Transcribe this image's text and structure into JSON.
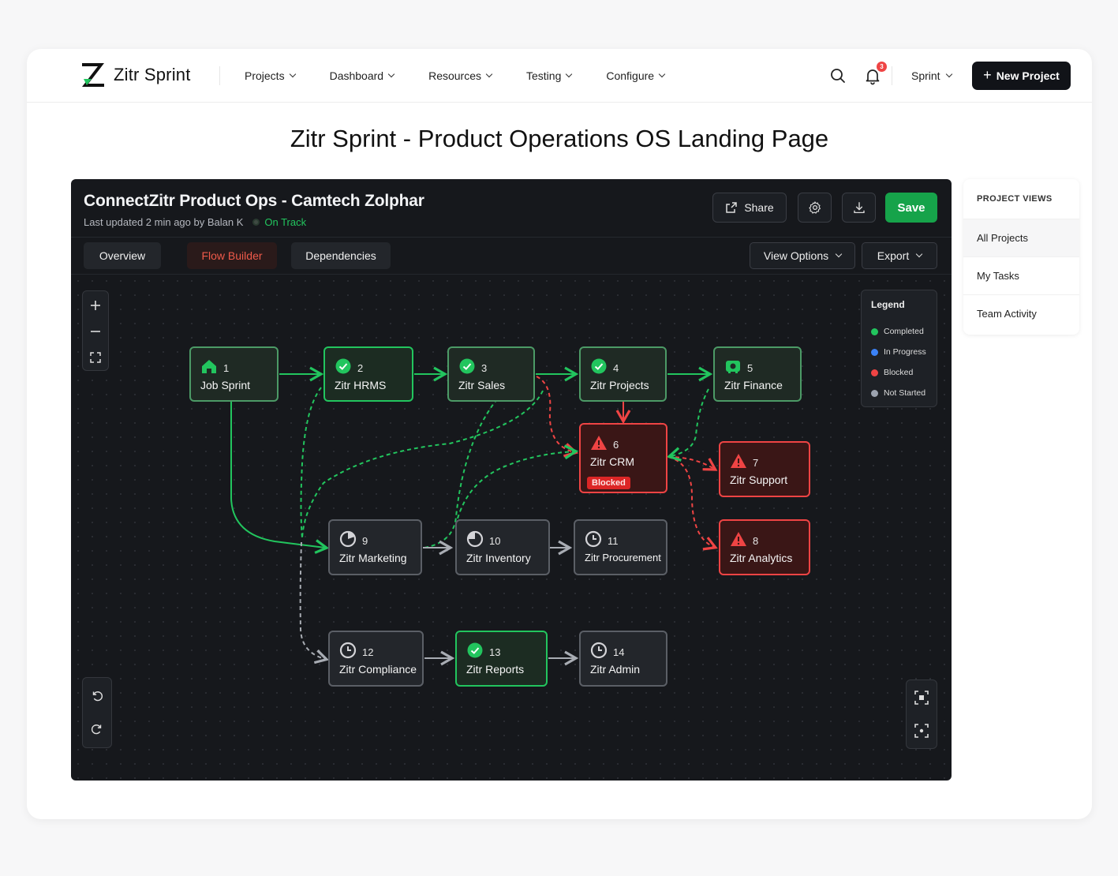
{
  "app": {
    "name": "Zitr Sprint"
  },
  "nav": {
    "items": [
      {
        "id": "projects",
        "label": "Projects"
      },
      {
        "id": "dashboard",
        "label": "Dashboard"
      },
      {
        "id": "resources",
        "label": "Resources"
      },
      {
        "id": "testing",
        "label": "Testing"
      },
      {
        "id": "configure",
        "label": "Configure"
      }
    ]
  },
  "header": {
    "notification_count": "3",
    "sprint_label": "Sprint",
    "new_project_label": "New Project"
  },
  "page": {
    "title": "Zitr Sprint - Product Operations OS Landing Page"
  },
  "project": {
    "title": "ConnectZitr Product Ops - Camtech Zolphar",
    "updated": "Last updated 2 min ago by Balan K",
    "status": "On Track",
    "share_label": "Share",
    "save_label": "Save"
  },
  "tabs": [
    {
      "label": "Overview",
      "active": false
    },
    {
      "label": "Flow Builder",
      "active": true
    },
    {
      "label": "Dependencies",
      "active": false
    }
  ],
  "toolbar": {
    "view_options_label": "View Options",
    "export_label": "Export"
  },
  "legend": {
    "title": "Legend",
    "items": [
      {
        "label": "Completed",
        "color": "#22c55e"
      },
      {
        "label": "In Progress",
        "color": "#3b82f6"
      },
      {
        "label": "Blocked",
        "color": "#ef4444"
      },
      {
        "label": "Not Started",
        "color": "#9ca3af"
      }
    ]
  },
  "nodes": [
    {
      "num": "1",
      "label": "Job Sprint",
      "status": "completed",
      "icon": "home-icon"
    },
    {
      "num": "2",
      "label": "Zitr HRMS",
      "status": "completed",
      "icon": "check-circle-icon"
    },
    {
      "num": "3",
      "label": "Zitr Sales",
      "status": "completed",
      "icon": "check-circle-icon"
    },
    {
      "num": "4",
      "label": "Zitr Projects",
      "status": "completed",
      "icon": "check-circle-icon"
    },
    {
      "num": "5",
      "label": "Zitr Finance",
      "status": "completed",
      "icon": "finance-icon"
    },
    {
      "num": "6",
      "label": "Zitr CRM",
      "status": "blocked",
      "icon": "warning-icon",
      "badge": "Blocked"
    },
    {
      "num": "7",
      "label": "Zitr Support",
      "status": "blocked",
      "icon": "warning-icon"
    },
    {
      "num": "8",
      "label": "Zitr Analytics",
      "status": "blocked",
      "icon": "warning-icon"
    },
    {
      "num": "9",
      "label": "Zitr Marketing",
      "status": "not-started",
      "icon": "chart-icon"
    },
    {
      "num": "10",
      "label": "Zitr Inventory",
      "status": "not-started",
      "icon": "progress-icon"
    },
    {
      "num": "11",
      "label": "Zitr Procurement",
      "status": "not-started",
      "icon": "clock-icon"
    },
    {
      "num": "12",
      "label": "Zitr Compliance",
      "status": "not-started",
      "icon": "clock-icon"
    },
    {
      "num": "13",
      "label": "Zitr Reports",
      "status": "completed",
      "icon": "check-circle-icon"
    },
    {
      "num": "14",
      "label": "Zitr Admin",
      "status": "not-started",
      "icon": "clock-icon"
    }
  ],
  "views": {
    "title": "PROJECT VIEWS",
    "items": [
      {
        "label": "All Projects",
        "active": true
      },
      {
        "label": "My Tasks",
        "active": false
      },
      {
        "label": "Team Activity",
        "active": false
      }
    ]
  },
  "colors": {
    "accent_green": "#16a34a",
    "blocked_red": "#ef4444",
    "panel_bg": "#16181c"
  }
}
